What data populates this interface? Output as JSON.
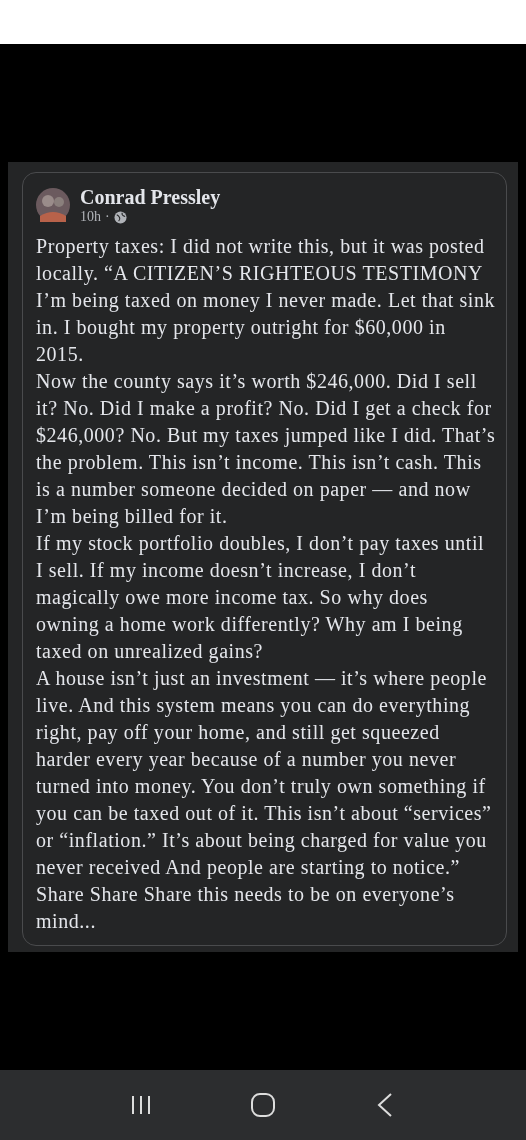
{
  "post": {
    "author": "Conrad Pressley",
    "time": "10h",
    "separator": "·",
    "paragraphs": [
      "Property taxes: I did not write this, but it was posted locally. “A CITIZEN’S RIGHTEOUS TESTIMONY I’m being taxed on money I never made. Let that sink in. I bought my property outright for $60,000 in 2015.",
      "Now the county says it’s worth $246,000. Did I sell it? No. Did I make a profit? No. Did I get a check for $246,000? No. But my taxes jumped like I did. That’s the problem. This isn’t income. This isn’t cash. This is a number someone decided on paper — and now I’m being billed for it.",
      "If my stock portfolio doubles, I don’t pay taxes until I sell. If my income doesn’t increase, I don’t magically owe more income tax. So why does owning a home work differently? Why am I being taxed on unrealized gains?",
      "A house isn’t just an investment — it’s where people live. And this system means you can do everything right, pay off your home, and still get squeezed harder every year because of a number you never turned into money. You don’t truly own something if you can be taxed out of it. This isn’t about “services” or “inflation.” It’s about being charged for value you never received And people are starting to notice.” Share Share Share this needs to be on everyone’s mind..."
    ]
  },
  "nav_bar": [
    {
      "kind": "recents"
    },
    {
      "kind": "home"
    },
    {
      "kind": "back"
    }
  ]
}
